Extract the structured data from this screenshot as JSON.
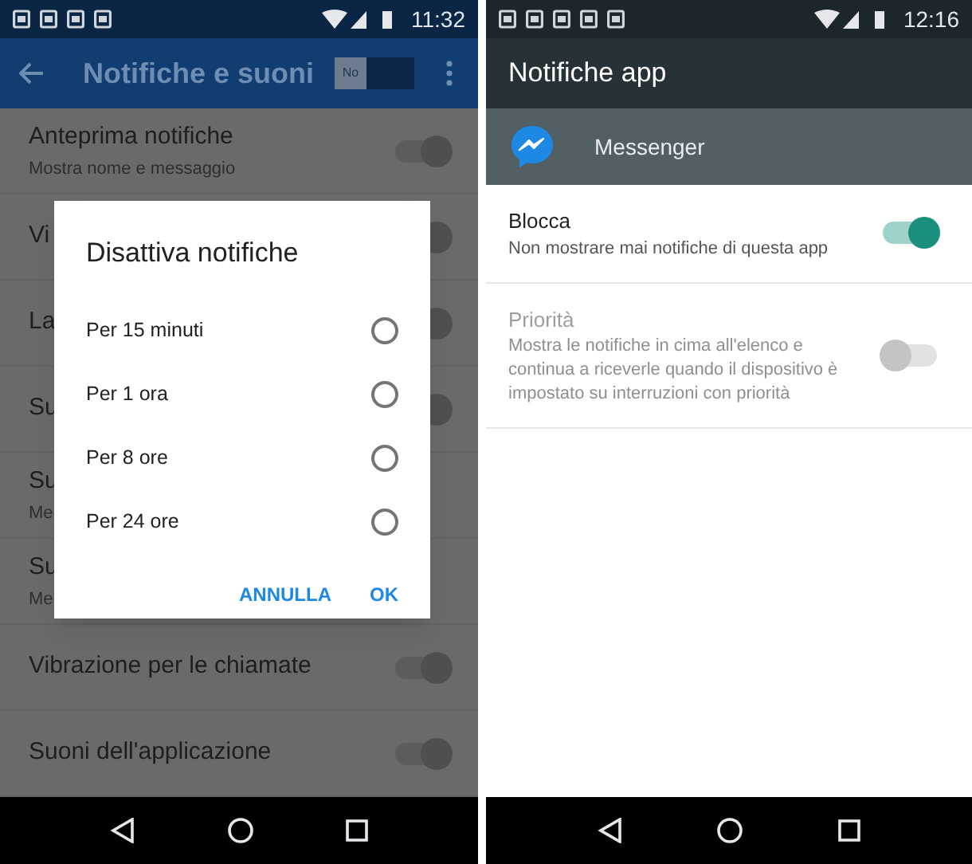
{
  "left": {
    "status_bar": {
      "time": "11:32"
    },
    "app_bar": {
      "title": "Notifiche e suoni",
      "switch_label": "No",
      "switch_on": false
    },
    "settings": [
      {
        "kind": "switch",
        "title": "Anteprima notifiche",
        "subtitle": "Mostra nome e messaggio",
        "on": true
      },
      {
        "kind": "switch",
        "title": "Vi",
        "on": true
      },
      {
        "kind": "switch",
        "title": "La",
        "on": true
      },
      {
        "kind": "switch",
        "title": "Su",
        "on": true
      },
      {
        "kind": "text",
        "title": "Su",
        "subtitle": "Me"
      },
      {
        "kind": "text",
        "title": "Su",
        "subtitle": "Me"
      },
      {
        "kind": "switch",
        "title": "Vibrazione per le chiamate",
        "on": true
      },
      {
        "kind": "switch",
        "title": "Suoni dell'applicazione",
        "on": true
      }
    ],
    "dialog": {
      "title": "Disattiva notifiche",
      "options": [
        {
          "label": "Per 15 minuti",
          "selected": false
        },
        {
          "label": "Per 1 ora",
          "selected": false
        },
        {
          "label": "Per 8 ore",
          "selected": false
        },
        {
          "label": "Per 24 ore",
          "selected": false
        }
      ],
      "buttons": [
        "ANNULLA",
        "OK"
      ]
    }
  },
  "right": {
    "status_bar": {
      "time": "12:16"
    },
    "app_bar": {
      "title": "Notifiche app"
    },
    "app_row": {
      "name": "Messenger"
    },
    "settings": [
      {
        "title": "Blocca",
        "subtitle": "Non mostrare mai notifiche di questa app",
        "on": true,
        "disabled": false
      },
      {
        "title": "Priorità",
        "subtitle": "Mostra le notifiche in cima all'elenco e continua a riceverle quando il dispositivo è impostato su interruzioni con priorità",
        "on": false,
        "disabled": true
      }
    ]
  }
}
